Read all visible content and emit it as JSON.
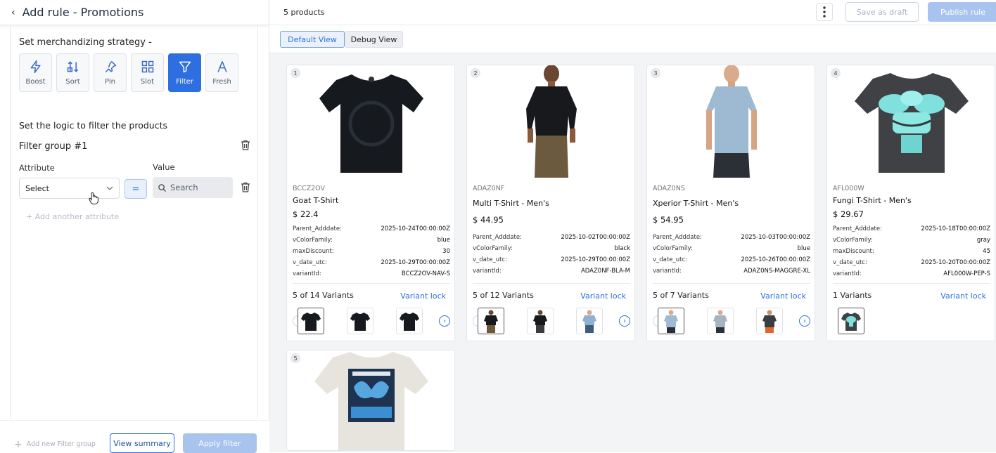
{
  "header": {
    "back_icon": "chevron-left-icon",
    "title": "Add rule - Promotions"
  },
  "strategy": {
    "title": "Set merchandizing strategy -",
    "options": [
      {
        "label": "Boost",
        "icon": "bolt-icon",
        "active": false
      },
      {
        "label": "Sort",
        "icon": "sort-icon",
        "active": false
      },
      {
        "label": "Pin",
        "icon": "pin-icon",
        "active": false
      },
      {
        "label": "Slot",
        "icon": "grid-icon",
        "active": false
      },
      {
        "label": "Filter",
        "icon": "filter-icon",
        "active": true
      },
      {
        "label": "Fresh",
        "icon": "fresh-icon",
        "active": false
      }
    ]
  },
  "filter": {
    "logic_title": "Set the logic to filter the products",
    "group_title": "Filter group #1",
    "attribute_label": "Attribute",
    "value_label": "Value",
    "select_value": "Select",
    "operator": "=",
    "search_placeholder": "Search",
    "add_attribute": "+ Add another attribute"
  },
  "footer": {
    "add_group": "Add new Filter group",
    "view_summary": "View summary",
    "apply": "Apply filter"
  },
  "topbar": {
    "product_count": "5 products",
    "save_draft": "Save as draft",
    "publish": "Publish rule"
  },
  "views": {
    "default": "Default View",
    "debug": "Debug View"
  },
  "colors": {
    "accent": "#2d6fe0",
    "accent_light": "#a9c3ef"
  },
  "products": [
    {
      "index": "1",
      "sku": "BCCZ2OV",
      "name": "Goat T-Shirt",
      "price": "$ 22.4",
      "attributes": [
        [
          "Parent_Adddate:",
          "2025-10-24T00:00:00Z"
        ],
        [
          "vColorFamily:",
          "blue"
        ],
        [
          "maxDiscount:",
          "30"
        ],
        [
          "v_date_utc:",
          "2025-10-29T00:00:00Z"
        ],
        [
          "variantId:",
          "BCCZ2OV-NAV-S"
        ]
      ],
      "variants": "5 of 14 Variants",
      "variant_lock": "Variant lock"
    },
    {
      "index": "2",
      "sku": "ADAZ0NF",
      "name": "Multi T-Shirt - Men's",
      "price": "$ 44.95",
      "attributes": [
        [
          "Parent_Adddate:",
          "2025-10-02T00:00:00Z"
        ],
        [
          "vColorFamily:",
          "black"
        ],
        [
          "v_date_utc:",
          "2025-10-29T00:00:00Z"
        ],
        [
          "variantId:",
          "ADAZ0NF-BLA-M"
        ]
      ],
      "variants": "5 of 12 Variants",
      "variant_lock": "Variant lock"
    },
    {
      "index": "3",
      "sku": "ADAZ0NS",
      "name": "Xperior T-Shirt - Men's",
      "price": "$ 54.95",
      "attributes": [
        [
          "Parent_Adddate:",
          "2025-10-03T00:00:00Z"
        ],
        [
          "vColorFamily:",
          "blue"
        ],
        [
          "v_date_utc:",
          "2025-10-26T00:00:00Z"
        ],
        [
          "variantId:",
          "ADAZ0NS-MAGGRE-XL"
        ]
      ],
      "variants": "5 of 7 Variants",
      "variant_lock": "Variant lock"
    },
    {
      "index": "4",
      "sku": "AFL000W",
      "name": "Fungi T-Shirt - Men's",
      "price": "$ 29.67",
      "attributes": [
        [
          "Parent_Adddate:",
          "2025-10-18T00:00:00Z"
        ],
        [
          "vColorFamily:",
          "gray"
        ],
        [
          "maxDiscount:",
          "45"
        ],
        [
          "v_date_utc:",
          "2025-10-20T00:00:00Z"
        ],
        [
          "variantId:",
          "AFL000W-PEP-S"
        ]
      ],
      "variants": "1 Variants",
      "variant_lock": "Variant lock"
    },
    {
      "index": "5"
    }
  ]
}
